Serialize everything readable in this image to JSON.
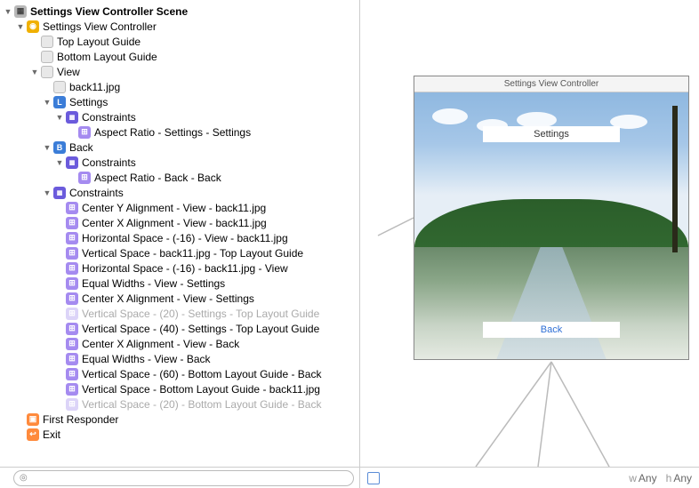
{
  "scene_title": "Settings View Controller Scene",
  "vc_title": "Settings View Controller",
  "phone_title": "Settings View Controller",
  "topGuide": "Top Layout Guide",
  "bottomGuide": "Bottom Layout Guide",
  "view": "View",
  "items": {
    "back11": "back11.jpg",
    "settings_label": "Settings",
    "back_button": "Back",
    "constraints_label": "Constraints",
    "aspect_settings": "Aspect Ratio - Settings - Settings",
    "aspect_back": "Aspect Ratio - Back - Back",
    "centerY_view_back11": "Center Y Alignment - View - back11.jpg",
    "centerX_view_back11": "Center X Alignment - View - back11.jpg",
    "hspace_neg16_view_back11": "Horizontal Space - (-16) - View - back11.jpg",
    "vspace_back11_topguide": "Vertical Space - back11.jpg - Top Layout Guide",
    "hspace_neg16_back11_view": "Horizontal Space - (-16) - back11.jpg - View",
    "eqw_view_settings": "Equal Widths - View - Settings",
    "centerX_view_settings": "Center X Alignment - View - Settings",
    "vspace_20_settings_topguide": "Vertical Space - (20) - Settings - Top Layout Guide",
    "vspace_40_settings_topguide": "Vertical Space - (40) - Settings - Top Layout Guide",
    "centerX_view_back": "Center X Alignment - View - Back",
    "eqw_view_back": "Equal Widths - View - Back",
    "vspace_60_bottomguide_back": "Vertical Space - (60) - Bottom Layout Guide - Back",
    "vspace_bottomguide_back11": "Vertical Space - Bottom Layout Guide - back11.jpg",
    "vspace_20_bottomguide_back": "Vertical Space - (20) - Bottom Layout Guide - Back"
  },
  "firstResponder": "First Responder",
  "exit": "Exit",
  "phone": {
    "settings_btn": "Settings",
    "back_btn": "Back"
  },
  "sizeclass": {
    "w": "w",
    "wval": "Any",
    "h": "h",
    "hval": "Any"
  },
  "search_placeholder": ""
}
